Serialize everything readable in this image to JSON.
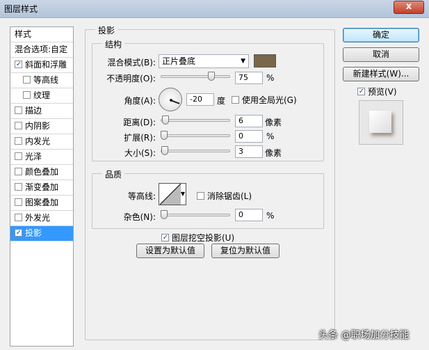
{
  "window": {
    "title": "图层样式",
    "close": "x"
  },
  "sidebar": {
    "header": "样式",
    "blend_options": "混合选项:自定",
    "items": [
      {
        "label": "斜面和浮雕",
        "checked": true
      },
      {
        "label": "等高线",
        "checked": false
      },
      {
        "label": "纹理",
        "checked": false
      },
      {
        "label": "描边",
        "checked": false
      },
      {
        "label": "内阴影",
        "checked": false
      },
      {
        "label": "内发光",
        "checked": false
      },
      {
        "label": "光泽",
        "checked": false
      },
      {
        "label": "颜色叠加",
        "checked": false
      },
      {
        "label": "渐变叠加",
        "checked": false
      },
      {
        "label": "图案叠加",
        "checked": false
      },
      {
        "label": "外发光",
        "checked": false
      },
      {
        "label": "投影",
        "checked": true,
        "selected": true
      }
    ]
  },
  "panel": {
    "title": "投影",
    "structure": {
      "title": "结构",
      "blend_mode_label": "混合模式(B):",
      "blend_mode_value": "正片叠底",
      "shadow_color": "#7a6648",
      "opacity_label": "不透明度(O):",
      "opacity_value": "75",
      "opacity_unit": "%",
      "opacity_level": 0.75,
      "angle_label": "角度(A):",
      "angle_value": "-20",
      "angle_unit": "度",
      "global_light_label": "使用全局光(G)",
      "global_light_checked": false,
      "distance_label": "距离(D):",
      "distance_value": "6",
      "distance_unit": "像素",
      "distance_level": 0.02,
      "spread_label": "扩展(R):",
      "spread_value": "0",
      "spread_unit": "%",
      "spread_level": 0,
      "size_label": "大小(S):",
      "size_value": "3",
      "size_unit": "像素",
      "size_level": 0.01
    },
    "quality": {
      "title": "品质",
      "contour_label": "等高线:",
      "antialias_label": "消除锯齿(L)",
      "antialias_checked": false,
      "noise_label": "杂色(N):",
      "noise_value": "0",
      "noise_unit": "%",
      "noise_level": 0
    },
    "knockout_label": "图层挖空投影(U)",
    "knockout_checked": true,
    "make_default": "设置为默认值",
    "reset_default": "复位为默认值"
  },
  "buttons": {
    "ok": "确定",
    "cancel": "取消",
    "new_style": "新建样式(W)...",
    "preview_label": "预览(V)",
    "preview_checked": true
  },
  "watermark": "头条 @职场加分技能"
}
